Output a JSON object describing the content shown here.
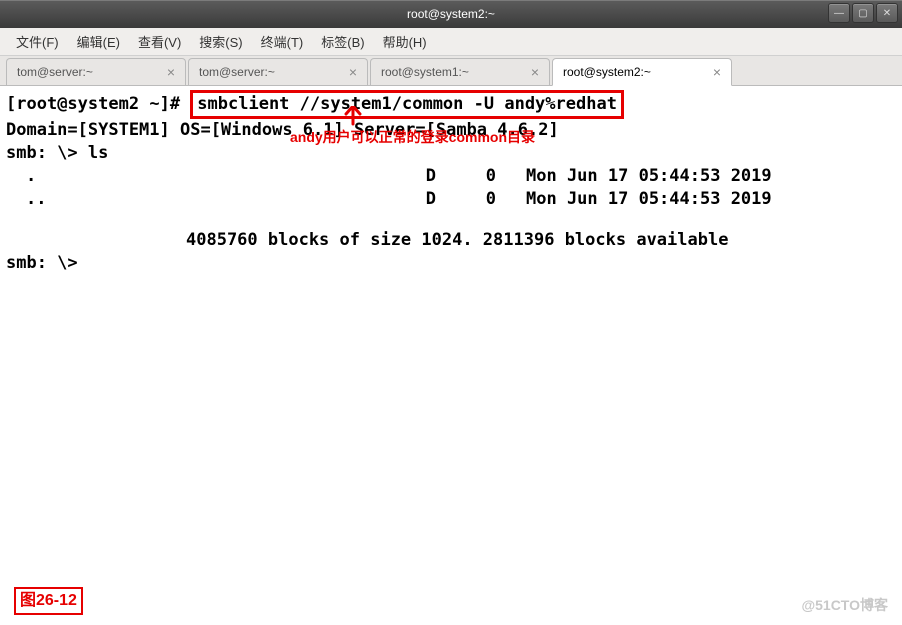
{
  "window": {
    "title": "root@system2:~"
  },
  "menu": {
    "file": "文件(F)",
    "edit": "编辑(E)",
    "view": "查看(V)",
    "search": "搜索(S)",
    "terminal": "终端(T)",
    "tabs": "标签(B)",
    "help": "帮助(H)"
  },
  "tabs": [
    {
      "label": "tom@server:~",
      "active": false
    },
    {
      "label": "tom@server:~",
      "active": false
    },
    {
      "label": "root@system1:~",
      "active": false
    },
    {
      "label": "root@system2:~",
      "active": true
    }
  ],
  "terminal": {
    "prompt_user": "root@system2",
    "prompt_path": "~",
    "command": "smbclient //system1/common -U andy%redhat",
    "response_domain": "Domain=[SYSTEM1] OS=[Windows 6.1] Server=[Samba 4.6.2]",
    "smb_prompt": "smb: \\>",
    "ls_cmd": "ls",
    "entries": [
      {
        "name": ".",
        "type": "D",
        "size": "0",
        "date": "Mon Jun 17 05:44:53 2019"
      },
      {
        "name": "..",
        "type": "D",
        "size": "0",
        "date": "Mon Jun 17 05:44:53 2019"
      }
    ],
    "blocks": "4085760 blocks of size 1024. 2811396 blocks available",
    "smb_prompt2": "smb: \\>"
  },
  "annotation": {
    "text": "andy用户可以正常的登录common目录",
    "figure": "图26-12"
  },
  "watermark": "@51CTO博客"
}
